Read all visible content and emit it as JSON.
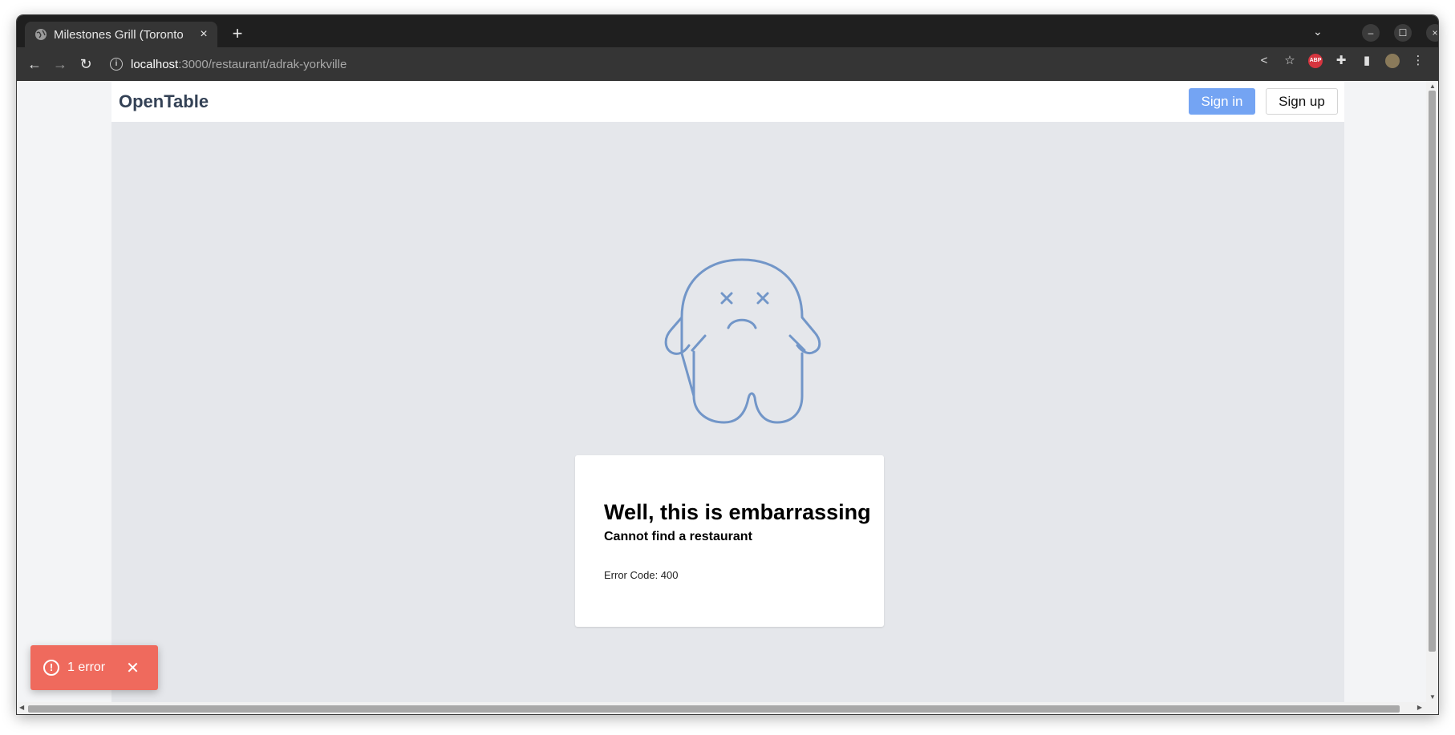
{
  "browser": {
    "tab_title": "Milestones Grill (Toronto",
    "tab_close": "×",
    "new_tab": "+",
    "url_host": "localhost",
    "url_path": ":3000/restaurant/adrak-yorkville",
    "minimize": "–",
    "maximize": "☐",
    "close": "×"
  },
  "navbar": {
    "brand": "OpenTable",
    "sign_in": "Sign in",
    "sign_up": "Sign up"
  },
  "error_card": {
    "title": "Well, this is embarrassing",
    "subtitle": "Cannot find a restaurant",
    "code": "Error Code: 400"
  },
  "toast": {
    "text": "1 error",
    "close": "✕"
  },
  "colors": {
    "accent": "#74a4f3",
    "ghost_stroke": "#7296c8",
    "toast_bg": "#ef6a5d"
  }
}
